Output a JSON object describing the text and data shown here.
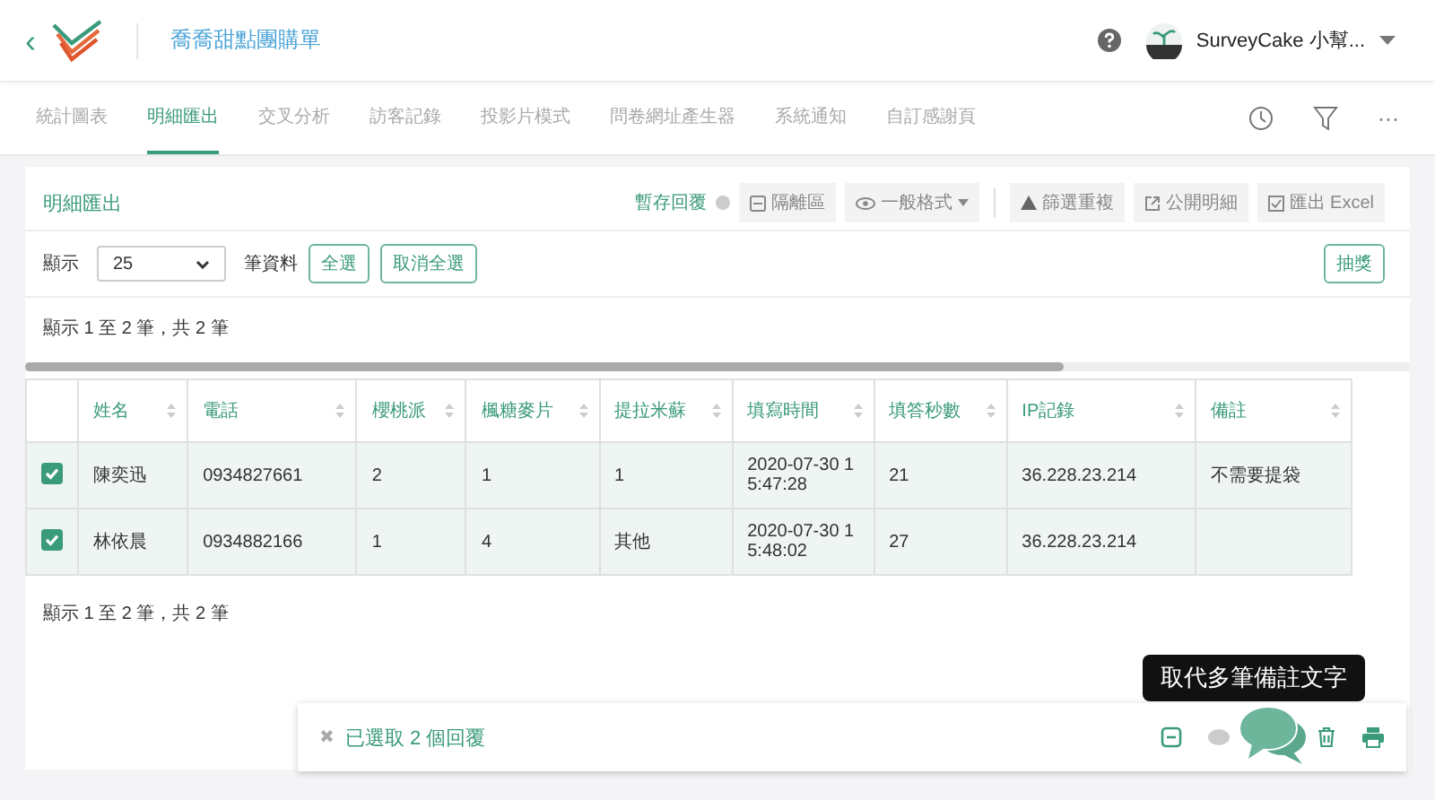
{
  "header": {
    "back": "‹",
    "title": "喬喬甜點團購單",
    "user": "SurveyCake 小幫..."
  },
  "tabs": [
    {
      "label": "統計圖表",
      "selected": false
    },
    {
      "label": "明細匯出",
      "selected": true
    },
    {
      "label": "交叉分析",
      "selected": false
    },
    {
      "label": "訪客記錄",
      "selected": false
    },
    {
      "label": "投影片模式",
      "selected": false
    },
    {
      "label": "問卷網址產生器",
      "selected": false
    },
    {
      "label": "系統通知",
      "selected": false
    },
    {
      "label": "自訂感謝頁",
      "selected": false
    }
  ],
  "more": "···",
  "panel": {
    "title": "明細匯出",
    "save_link": "暫存回覆",
    "tools": [
      {
        "label": "隔離區",
        "kind": "box"
      },
      {
        "label": "一般格式",
        "kind": "eye"
      },
      {
        "label": "篩選重複",
        "kind": "warn"
      },
      {
        "label": "公開明細",
        "kind": "share"
      },
      {
        "label": "匯出 Excel",
        "kind": "excel"
      }
    ],
    "show_label": "顯示",
    "page_size": "25",
    "rows_label": "筆資料",
    "select_all": "全選",
    "deselect_all": "取消全選",
    "draw": "抽獎",
    "summary_top": "顯示 1 至 2 筆，共 2 筆",
    "summary_bottom": "顯示 1 至 2 筆，共 2 筆"
  },
  "table": {
    "columns": [
      "姓名",
      "電話",
      "櫻桃派",
      "楓糖麥片",
      "提拉米蘇",
      "填寫時間",
      "填答秒數",
      "IP記錄",
      "備註"
    ],
    "rows": [
      {
        "checked": true,
        "cells": [
          "陳奕迅",
          "0934827661",
          "2",
          "1",
          "1",
          "2020-07-30 15:47:28",
          "21",
          "36.228.23.214",
          "不需要提袋"
        ]
      },
      {
        "checked": true,
        "cells": [
          "林依晨",
          "0934882166",
          "1",
          "4",
          "其他",
          "2020-07-30 15:48:02",
          "27",
          "36.228.23.214",
          ""
        ]
      }
    ]
  },
  "action_bar": {
    "close": "✖",
    "selected_text": "已選取 2 個回覆",
    "tooltip": "取代多筆備註文字"
  }
}
